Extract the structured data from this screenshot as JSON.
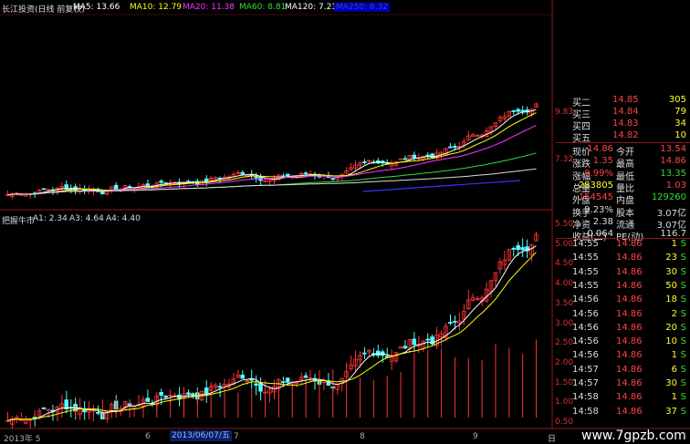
{
  "header": {
    "title": "长江投资(日线 前复权)",
    "ma": [
      {
        "label": "MA5: 13.66",
        "color": "#ffffff"
      },
      {
        "label": "MA10: 12.79",
        "color": "#ffff00"
      },
      {
        "label": "MA20: 11.38",
        "color": "#ff33ff"
      },
      {
        "label": "MA60: 8.81",
        "color": "#33dd33"
      },
      {
        "label": "MA120: 7.21",
        "color": "#ffffff"
      },
      {
        "label": "MA250: 6.32",
        "color": "#3333ff"
      }
    ]
  },
  "indicator": {
    "name": "把握牛市",
    "items": [
      "A1: 2.34",
      "A3: 4.64",
      "A4: 4.40"
    ]
  },
  "axis": {
    "price_ticks": [
      "9.83",
      "7.32"
    ],
    "ind_ticks": [
      "5.50",
      "5.00",
      "4.50",
      "4.00",
      "3.50",
      "3.00",
      "2.50",
      "2.00",
      "1.50",
      "1.00",
      "0.50"
    ],
    "x_ticks": [
      "2013年 5",
      "6",
      "7",
      "8",
      "9"
    ],
    "date_cursor": "2013/06/07/五",
    "scale_btn": "日"
  },
  "quote": {
    "levels": [
      {
        "label": "买二",
        "price": "14.85",
        "vol": "305"
      },
      {
        "label": "买三",
        "price": "14.84",
        "vol": "79"
      },
      {
        "label": "买四",
        "price": "14.83",
        "vol": "34"
      },
      {
        "label": "买五",
        "price": "14.82",
        "vol": "10"
      }
    ],
    "stats": [
      {
        "l1": "现价",
        "v1": "14.86",
        "l2": "今开",
        "v2": "13.54",
        "c1": "#ff4444",
        "c2": "#ff4444"
      },
      {
        "l1": "涨跌",
        "v1": "1.35",
        "l2": "最高",
        "v2": "14.86",
        "c1": "#ff4444",
        "c2": "#ff4444"
      },
      {
        "l1": "涨幅",
        "v1": "9.99%",
        "l2": "最低",
        "v2": "13.35",
        "c1": "#ff4444",
        "c2": "#33dd33"
      },
      {
        "l1": "总量",
        "v1": "283805",
        "l2": "量比",
        "v2": "1.03",
        "c1": "#ffff33",
        "c2": "#ff4444"
      },
      {
        "l1": "外盘",
        "v1": "154545",
        "l2": "内盘",
        "v2": "129260",
        "c1": "#ff4444",
        "c2": "#33dd33"
      },
      {
        "l1": "换手",
        "v1": "9.23%",
        "l2": "股本",
        "v2": "3.07亿",
        "c1": "#dddddd",
        "c2": "#dddddd"
      },
      {
        "l1": "净资",
        "v1": "2.38",
        "l2": "流通",
        "v2": "3.07亿",
        "c1": "#dddddd",
        "c2": "#dddddd"
      },
      {
        "l1": "收益(二)",
        "v1": "0.064",
        "l2": "PE(动)",
        "v2": "116.7",
        "c1": "#dddddd",
        "c2": "#dddddd"
      }
    ],
    "ticks": [
      {
        "t": "14:55",
        "p": "14.86",
        "v": "1",
        "s": "S"
      },
      {
        "t": "14:55",
        "p": "14.86",
        "v": "23",
        "s": "S"
      },
      {
        "t": "14:55",
        "p": "14.86",
        "v": "30",
        "s": "S"
      },
      {
        "t": "14:55",
        "p": "14.86",
        "v": "50",
        "s": "S"
      },
      {
        "t": "14:56",
        "p": "14.86",
        "v": "18",
        "s": "S"
      },
      {
        "t": "14:56",
        "p": "14.86",
        "v": "2",
        "s": "S"
      },
      {
        "t": "14:56",
        "p": "14.86",
        "v": "20",
        "s": "S"
      },
      {
        "t": "14:56",
        "p": "14.86",
        "v": "10",
        "s": "S"
      },
      {
        "t": "14:56",
        "p": "14.86",
        "v": "1",
        "s": "S"
      },
      {
        "t": "14:57",
        "p": "14.86",
        "v": "6",
        "s": "S"
      },
      {
        "t": "14:57",
        "p": "14.86",
        "v": "30",
        "s": "S"
      },
      {
        "t": "14:58",
        "p": "14.86",
        "v": "1",
        "s": "S"
      },
      {
        "t": "14:58",
        "p": "14.86",
        "v": "37",
        "s": "S"
      }
    ]
  },
  "watermark": "www.7gpzb.com"
}
